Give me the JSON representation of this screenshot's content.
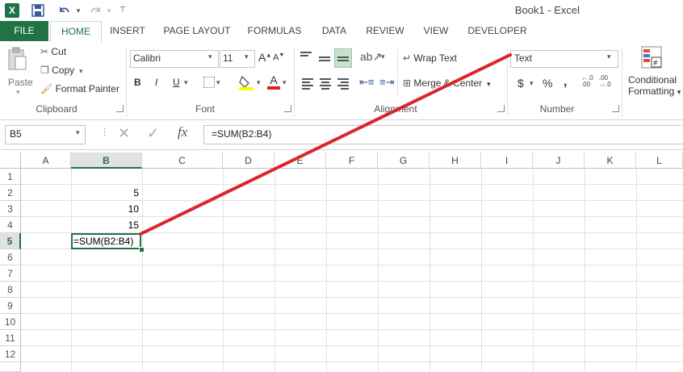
{
  "app": {
    "window_title": "Book1 - Excel",
    "logo_letter": "X",
    "accent": "#217346",
    "annotation_color": "#d9262b"
  },
  "quick_access": {
    "save_icon": "save-icon",
    "undo_icon": "undo-icon",
    "redo_icon": "redo-icon",
    "customize_icon": "customize-icon"
  },
  "tabs": [
    "FILE",
    "HOME",
    "INSERT",
    "PAGE LAYOUT",
    "FORMULAS",
    "DATA",
    "REVIEW",
    "VIEW",
    "DEVELOPER"
  ],
  "clipboard": {
    "paste": "Paste",
    "cut": "Cut",
    "copy": "Copy",
    "format_painter": "Format Painter",
    "group": "Clipboard"
  },
  "font": {
    "name": "Calibri",
    "size": "11",
    "bold": "B",
    "italic": "I",
    "underline": "U",
    "font_color_glyph": "A",
    "group": "Font"
  },
  "alignment": {
    "wrap_text": "Wrap Text",
    "merge_center": "Merge & Center",
    "group": "Alignment"
  },
  "number": {
    "format": "Text",
    "currency": "$",
    "percent": "%",
    "comma": ",",
    "group": "Number"
  },
  "styles": {
    "conditional": "Conditional",
    "formatting": "Formatting"
  },
  "formula_bar": {
    "name_box": "B5",
    "cancel_glyph": "✕",
    "enter_glyph": "✓",
    "fx": "fx",
    "formula": "=SUM(B2:B4)"
  },
  "sheet": {
    "columns": [
      "A",
      "B",
      "C",
      "D",
      "E",
      "F",
      "G",
      "H",
      "I",
      "J",
      "K",
      "L"
    ],
    "selected_column": "B",
    "rows": [
      "1",
      "2",
      "3",
      "4",
      "5",
      "6",
      "7",
      "8",
      "9",
      "10",
      "11",
      "12"
    ],
    "selected_row": "5",
    "cells": {
      "B2": "5",
      "B3": "10",
      "B4": "15",
      "B5": "=SUM(B2:B4)"
    }
  }
}
